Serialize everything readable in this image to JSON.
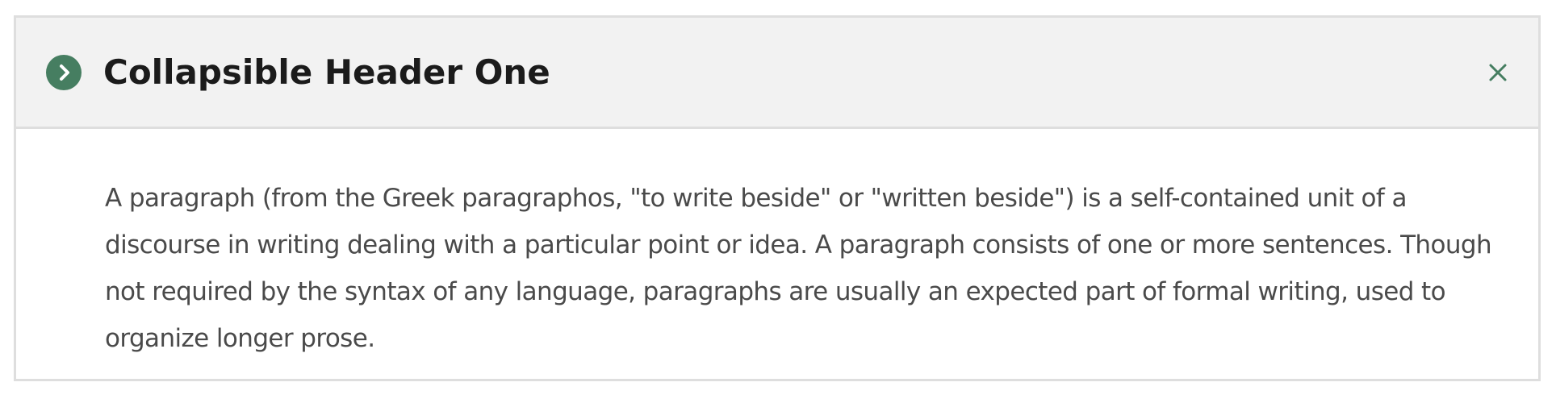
{
  "accordion": {
    "title": "Collapsible Header One",
    "toggle_icon": "chevron-right-icon",
    "close_icon": "close-icon",
    "accent_color": "#467e61",
    "header_background": "#f2f2f2",
    "border_color": "#dedede",
    "body_text": "A paragraph (from the Greek paragraphos, \"to write beside\" or \"written beside\") is a self-contained unit of a discourse in writing dealing with a particular point or idea. A paragraph consists of one or more sentences. Though not required by the syntax of any language, paragraphs are usually an expected part of formal writing, used to organize longer prose."
  }
}
